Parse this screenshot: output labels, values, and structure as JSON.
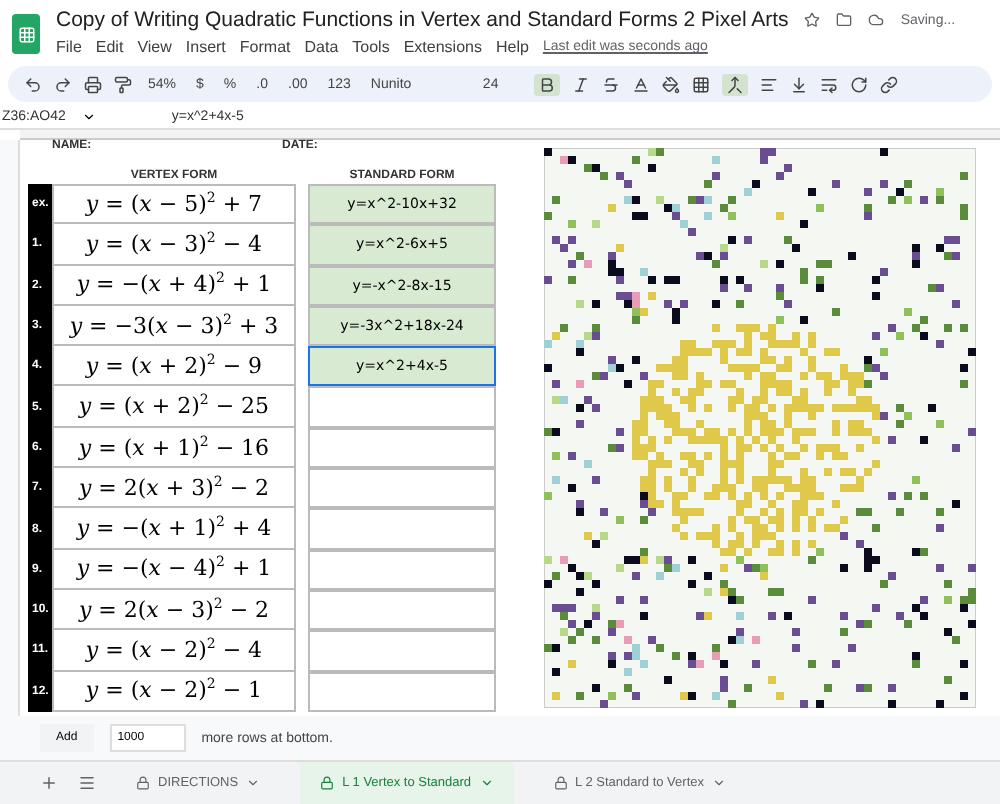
{
  "doc": {
    "title": "Copy of Writing Quadratic Functions in Vertex and Standard Forms 2 Pixel Arts",
    "status": "Saving...",
    "last_edit": "Last edit was seconds ago"
  },
  "menu": [
    "File",
    "Edit",
    "View",
    "Insert",
    "Format",
    "Data",
    "Tools",
    "Extensions",
    "Help"
  ],
  "toolbar": {
    "zoom": "54%",
    "format_items": [
      "$",
      "%",
      ".0",
      ".00",
      "123"
    ],
    "font": "Nunito",
    "size": "24",
    "bold_on": true,
    "merge_on": true
  },
  "formula_bar": {
    "cell_ref": "Z36:AO42",
    "formula": "y=x^2+4x-5"
  },
  "sheet": {
    "name_label": "NAME:",
    "date_label": "DATE:",
    "vertex_heading": "VERTEX FORM",
    "standard_heading": "STANDARD FORM",
    "rows": [
      {
        "label": "ex.",
        "vertex": "*y* = (*x* − 5)$^{2}$ + 7",
        "standard": "y=x^2-10x+32",
        "filled": true,
        "selected": false
      },
      {
        "label": "1.",
        "vertex": "*y* = (*x* − 3)$^{2}$ − 4",
        "standard": "y=x^2-6x+5",
        "filled": true,
        "selected": false
      },
      {
        "label": "2.",
        "vertex": "*y* = −(*x* + 4)$^{2}$ + 1",
        "standard": "y=-x^2-8x-15",
        "filled": true,
        "selected": false
      },
      {
        "label": "3.",
        "vertex": "*y* = −3(*x* − 3)$^{2}$ + 3",
        "standard": "y=-3x^2+18x-24",
        "filled": true,
        "selected": false
      },
      {
        "label": "4.",
        "vertex": "*y* = (*x* + 2)$^{2}$ − 9",
        "standard": "y=x^2+4x-5",
        "filled": true,
        "selected": true
      },
      {
        "label": "5.",
        "vertex": "*y* = (*x* + 2)$^{2}$ − 25",
        "filled": false,
        "selected": false
      },
      {
        "label": "6.",
        "vertex": "*y* = (*x* + 1)$^{2}$ − 16",
        "filled": false,
        "selected": false
      },
      {
        "label": "7.",
        "vertex": "*y* = 2(*x* + 3)$^{2}$ − 2",
        "filled": false,
        "selected": false
      },
      {
        "label": "8.",
        "vertex": "*y* = −(*x* + 1)$^{2}$ + 4",
        "filled": false,
        "selected": false
      },
      {
        "label": "9.",
        "vertex": "*y* = −(*x* − 4)$^{2}$ + 1",
        "filled": false,
        "selected": false
      },
      {
        "label": "10.",
        "vertex": "*y* = 2(*x* − 3)$^{2}$ − 2",
        "filled": false,
        "selected": false
      },
      {
        "label": "11.",
        "vertex": "*y* = (*x* − 2)$^{2}$ − 4",
        "filled": false,
        "selected": false
      },
      {
        "label": "12.",
        "vertex": "*y* = (*x* − 2)$^{2}$ − 1",
        "filled": false,
        "selected": false
      }
    ]
  },
  "add_rows": {
    "button": "Add",
    "value": "1000",
    "text": "more rows at bottom."
  },
  "tabs": [
    {
      "label": "DIRECTIONS",
      "selected": false
    },
    {
      "label": "L 1 Vertex to Standard",
      "selected": true
    },
    {
      "label": "L 2 Standard to Vertex",
      "selected": false
    }
  ]
}
